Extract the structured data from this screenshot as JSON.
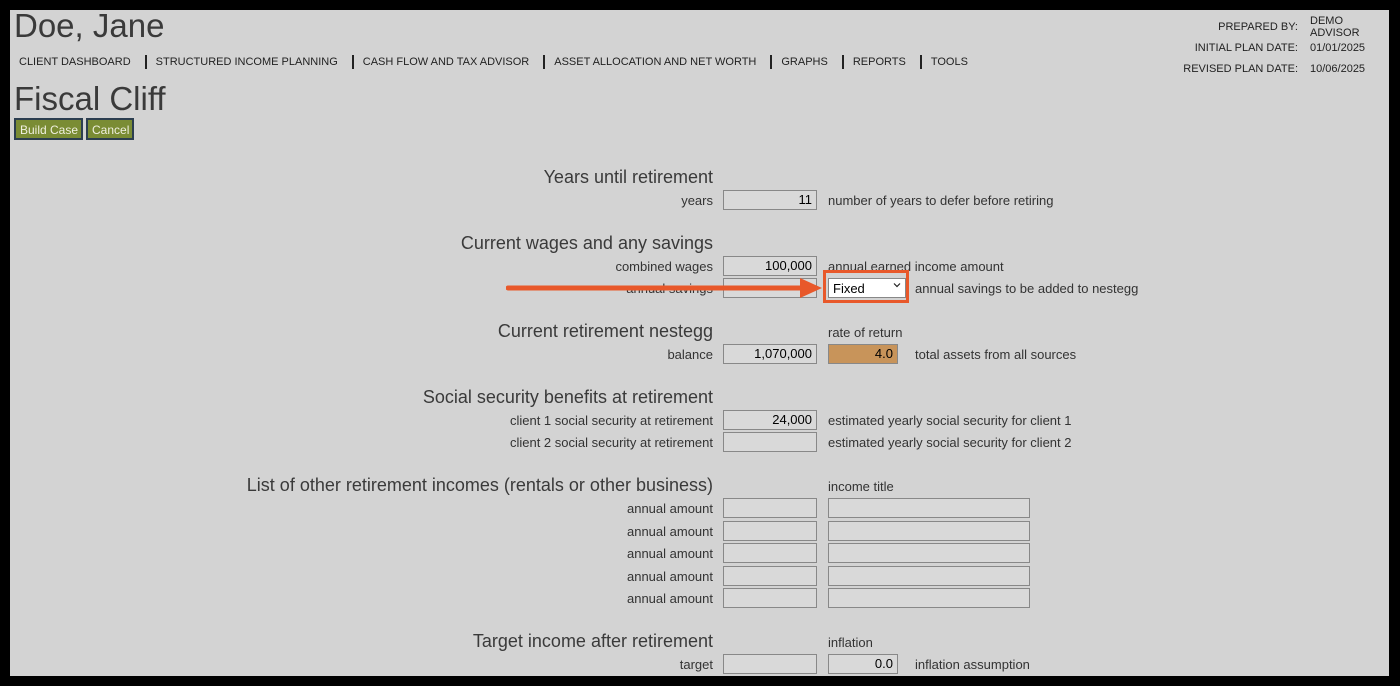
{
  "header": {
    "client_name": "Doe, Jane",
    "plan_info": [
      {
        "label": "PREPARED BY:",
        "value": "DEMO ADVISOR"
      },
      {
        "label": "INITIAL PLAN DATE:",
        "value": "01/01/2025"
      },
      {
        "label": "REVISED PLAN DATE:",
        "value": "10/06/2025"
      }
    ]
  },
  "nav": [
    "CLIENT DASHBOARD",
    "STRUCTURED INCOME PLANNING",
    "CASH FLOW AND TAX ADVISOR",
    "ASSET ALLOCATION AND NET WORTH",
    "GRAPHS",
    "REPORTS",
    "TOOLS"
  ],
  "page": {
    "title": "Fiscal Cliff",
    "build_case_label": "Build Case",
    "cancel_label": "Cancel"
  },
  "years": {
    "heading": "Years until retirement",
    "label": "years",
    "value": "11",
    "description": "number of years to defer before retiring"
  },
  "wages": {
    "heading": "Current wages and any savings",
    "combined_label": "combined wages",
    "combined_value": "100,000",
    "combined_desc": "annual earned income amount",
    "savings_label": "annual savings",
    "savings_value": "",
    "savings_type": "Fixed",
    "savings_desc": "annual savings to be added to nestegg"
  },
  "nestegg": {
    "heading": "Current retirement nestegg",
    "rate_header": "rate of return",
    "balance_label": "balance",
    "balance_value": "1,070,000",
    "rate_value": "4.0",
    "desc": "total assets from all sources"
  },
  "social": {
    "heading": "Social security benefits at retirement",
    "client1_label": "client 1 social security at retirement",
    "client1_value": "24,000",
    "client1_desc": "estimated yearly social security for client 1",
    "client2_label": "client 2 social security at retirement",
    "client2_value": "",
    "client2_desc": "estimated yearly social security for client 2"
  },
  "other_incomes": {
    "heading": "List of other retirement incomes (rentals or other business)",
    "title_header": "income title",
    "row_label": "annual amount",
    "rows": [
      {
        "amount": "",
        "title": ""
      },
      {
        "amount": "",
        "title": ""
      },
      {
        "amount": "",
        "title": ""
      },
      {
        "amount": "",
        "title": ""
      },
      {
        "amount": "",
        "title": ""
      }
    ]
  },
  "target": {
    "heading": "Target income after retirement",
    "inflation_header": "inflation",
    "label": "target",
    "value": "",
    "inflation_value": "0.0",
    "desc": "inflation assumption"
  },
  "colors": {
    "background": "#d3d3d3",
    "button": "#7a8c34",
    "highlight": "#e8582a",
    "rate_field": "#c8945a"
  }
}
